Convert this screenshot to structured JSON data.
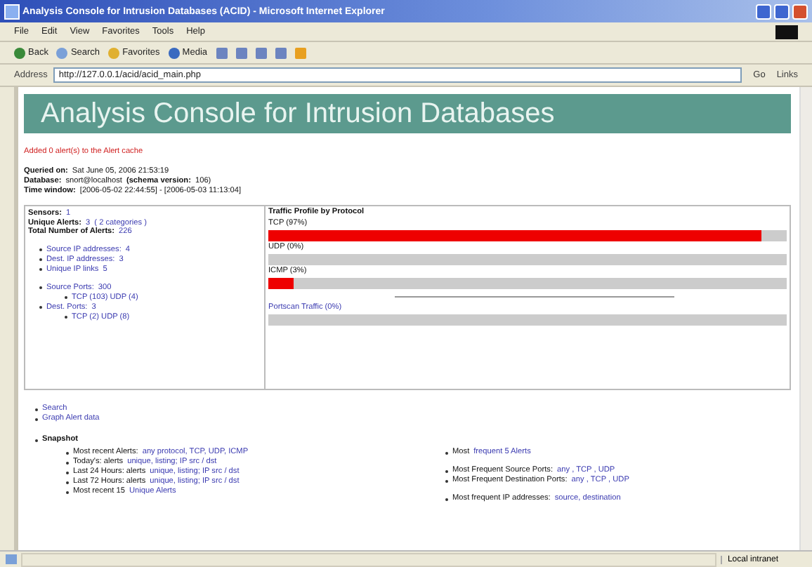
{
  "window": {
    "title": "Analysis Console for Intrusion Databases (ACID) - Microsoft Internet Explorer"
  },
  "menu": [
    "File",
    "Edit",
    "View",
    "Favorites",
    "Tools",
    "Help"
  ],
  "toolbar": [
    "Back",
    "Search",
    "Favorites",
    "Media"
  ],
  "address": {
    "label": "Address",
    "value": "http://127.0.0.1/acid/acid_main.php",
    "go": "Go",
    "links": "Links"
  },
  "page": {
    "title": "Analysis Console for Intrusion Databases",
    "notice": "Added 0 alert(s) to the Alert cache",
    "info": [
      {
        "label": "Queried on:",
        "value": "Sat June 05, 2006 21:53:19"
      },
      {
        "label": "Database:",
        "value": "snort@localhost",
        "extra_label": "(schema version:",
        "extra_value": "106)"
      },
      {
        "label": "Time window:",
        "value": "[2006-05-02 22:44:55] - [2006-05-03 11:13:04]"
      }
    ],
    "stats": [
      {
        "label": "Sensors:",
        "value": "1"
      },
      {
        "label": "Unique Alerts:",
        "value": "3",
        "extra": "( 2 categories )"
      },
      {
        "label": "Total Number of Alerts:",
        "value": "226"
      }
    ],
    "addresses": [
      {
        "label": "Source IP addresses:",
        "value": "4"
      },
      {
        "label": "Dest. IP addresses:",
        "value": "3"
      },
      {
        "label": "Unique IP links",
        "value": "5"
      }
    ],
    "ports": [
      {
        "label": "Source Ports:",
        "value": "300",
        "sub": "TCP (103)  UDP (4)"
      },
      {
        "label": "Dest. Ports:",
        "value": "3",
        "sub": "TCP (2)  UDP (8)"
      }
    ],
    "traffic": {
      "title": "Traffic Profile by Protocol",
      "protocols": [
        {
          "label": "TCP (97%)",
          "level": 0.95
        },
        {
          "label": "UDP (0%)",
          "level": 0
        },
        {
          "label": "ICMP (3%)",
          "level": 0.05
        },
        {
          "label": "Portscan Traffic (0%)",
          "level": 0,
          "separated": true
        }
      ]
    },
    "links": [
      "Search",
      "Graph Alert data"
    ],
    "snapshot": {
      "title": "Snapshot",
      "left": [
        [
          {
            "text": "Most recent Alerts:",
            "link": false
          },
          {
            "text": "any protocol, TCP, UDP, ICMP",
            "link": true
          }
        ],
        [
          {
            "text": "Today's: alerts",
            "link": false
          },
          {
            "text": "unique, listing; IP src / dst",
            "link": true
          }
        ],
        [
          {
            "text": "Last 24 Hours: alerts",
            "link": false
          },
          {
            "text": "unique, listing; IP src / dst",
            "link": true
          }
        ],
        [
          {
            "text": "Last 72 Hours: alerts",
            "link": false
          },
          {
            "text": "unique, listing; IP src / dst",
            "link": true
          }
        ],
        [
          {
            "text": "Most recent 15",
            "link": false
          },
          {
            "text": "Unique Alerts",
            "link": true
          }
        ]
      ],
      "right": [
        [
          {
            "text": "Most",
            "link": false
          },
          {
            "text": "frequent 5 Alerts",
            "link": true
          }
        ],
        [
          {
            "text": "Most Frequent Source Ports:",
            "link": false
          },
          {
            "text": "any , TCP , UDP",
            "link": true
          }
        ],
        [
          {
            "text": "Most Frequent Destination Ports:",
            "link": false
          },
          {
            "text": "any , TCP , UDP",
            "link": true
          }
        ],
        [
          {
            "text": "Most frequent IP addresses:",
            "link": false
          },
          {
            "text": "source, destination",
            "link": true
          }
        ]
      ]
    }
  },
  "status_bar": {
    "zone": "Local intranet"
  }
}
